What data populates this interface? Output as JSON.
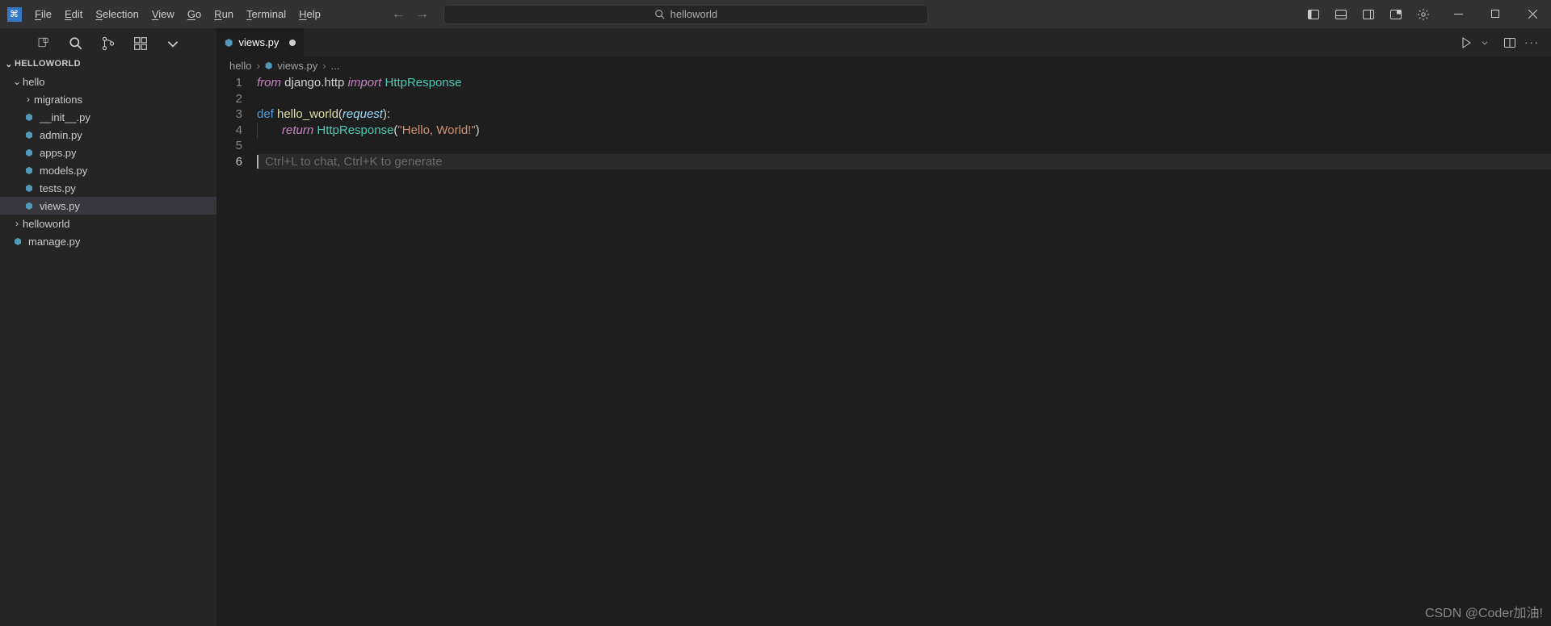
{
  "menu": [
    "File",
    "Edit",
    "Selection",
    "View",
    "Go",
    "Run",
    "Terminal",
    "Help"
  ],
  "search_text": "helloworld",
  "explorer_title": "HELLOWORLD",
  "tree": {
    "hello": "hello",
    "migrations": "migrations",
    "init": "__init__.py",
    "admin": "admin.py",
    "apps": "apps.py",
    "models": "models.py",
    "tests": "tests.py",
    "views": "views.py",
    "helloworld": "helloworld",
    "manage": "manage.py"
  },
  "tab": {
    "name": "views.py"
  },
  "breadcrumbs": {
    "folder": "hello",
    "file": "views.py",
    "more": "..."
  },
  "code": {
    "l1": {
      "frm": "from",
      "mod": "django.http",
      "imp": "import",
      "obj": "HttpResponse"
    },
    "l3": {
      "def": "def",
      "fn": "hello_world",
      "lp": "(",
      "param": "request",
      "rp": "):"
    },
    "l4": {
      "ret": "return",
      "cls": "HttpResponse",
      "lp": "(",
      "str": "\"Hello, World!\"",
      "rp": ")"
    },
    "hint": "Ctrl+L to chat, Ctrl+K to generate"
  },
  "line_numbers": [
    "1",
    "2",
    "3",
    "4",
    "5",
    "6"
  ],
  "watermark": "CSDN @Coder加油!"
}
